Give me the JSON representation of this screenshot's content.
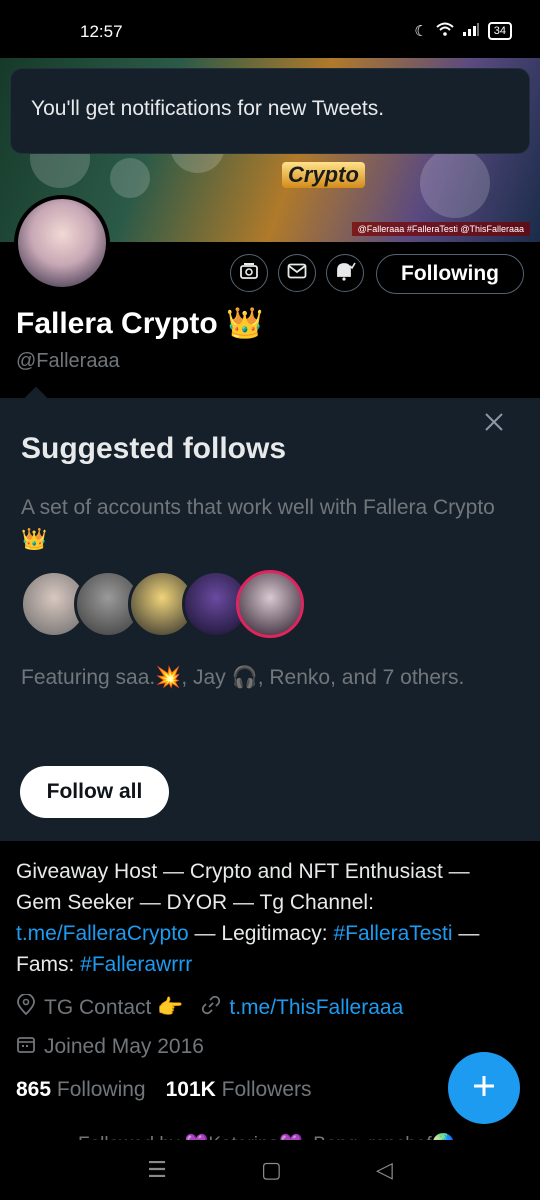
{
  "statusbar": {
    "time": "12:57",
    "battery": "34"
  },
  "toast": {
    "text": "You'll get notifications for new Tweets."
  },
  "banner": {
    "title_text": "Crypto",
    "handles_text": "@Falleraaa #FalleraTesti @ThisFalleraaa"
  },
  "profile": {
    "name": "Fallera Crypto",
    "name_emoji": "👑",
    "handle": "@Falleraaa",
    "follow_label": "Following"
  },
  "suggested": {
    "title": "Suggested follows",
    "description": "A set of accounts that work well with Fallera Crypto 👑",
    "featuring": "Featuring saa.💥, Jay 🎧, Renko, and 7 others.",
    "follow_all_label": "Follow all",
    "avatar_colors": [
      "#8a8a8a",
      "#5a5a5a",
      "#c9a445",
      "#3a2a5a",
      "#2a1a2a"
    ]
  },
  "bio": {
    "part1": "Giveaway Host — Crypto and NFT Enthusiast — Gem Seeker — DYOR  — Tg Channel: ",
    "link1": "t.me/FalleraCrypto",
    "part2": " — Legitimacy: ",
    "link2": "#FalleraTesti",
    "part3": " — Fams: ",
    "link3": "#Fallerawrrr"
  },
  "meta": {
    "location": "TG Contact 👉",
    "website": "t.me/ThisFalleraaa",
    "joined": "Joined May 2016"
  },
  "counts": {
    "following_num": "865",
    "following_label": "Following",
    "followers_num": "101K",
    "followers_label": "Followers"
  },
  "followed_by": "Followed by 💜Katerina💜, Beng_renchef🌏"
}
